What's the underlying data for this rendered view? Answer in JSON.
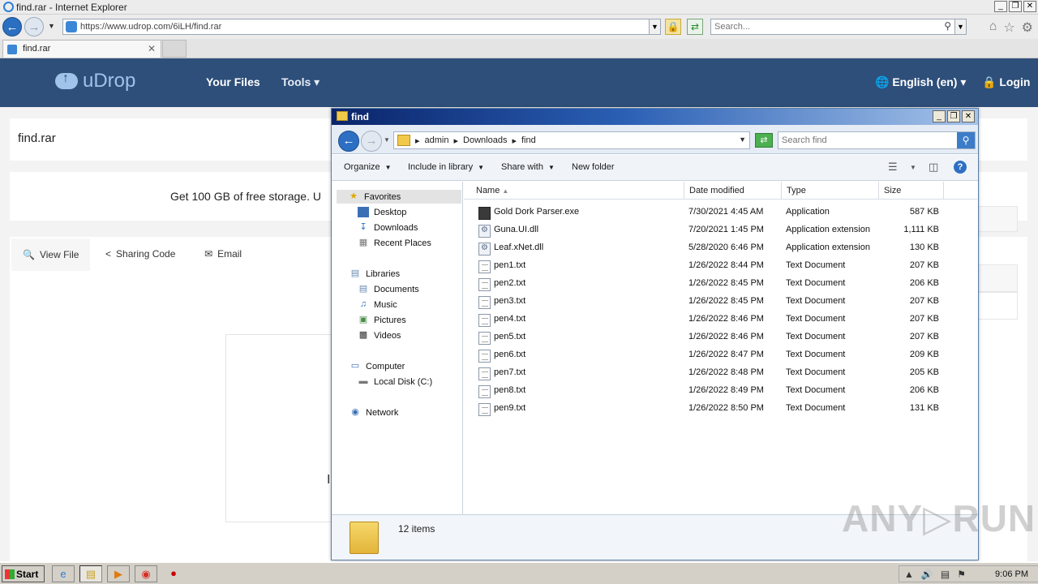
{
  "ie": {
    "title": "find.rar - Internet Explorer",
    "window_controls": [
      "_",
      "❐",
      "✕"
    ],
    "url": "https://www.udrop.com/6iLH/find.rar",
    "search_placeholder": "Search...",
    "tab_label": "find.rar",
    "tab_close": "✕"
  },
  "site": {
    "logo": "uDrop",
    "nav": {
      "your_files": "Your Files",
      "tools": "Tools ▾"
    },
    "language": "English (en) ▾",
    "login": "Login",
    "file_title": "find.rar",
    "promo": "Get 100 GB of free storage. U",
    "tabs": {
      "view_file": "View File",
      "sharing_code": "Sharing Code",
      "email": "Email"
    },
    "preview_char": "I"
  },
  "explorer": {
    "title": "find",
    "window_controls": [
      "_",
      "❐",
      "✕"
    ],
    "breadcrumb": [
      "admin",
      "Downloads",
      "find"
    ],
    "search_placeholder": "Search find",
    "commands": {
      "organize": "Organize",
      "include_in_library": "Include in library",
      "share_with": "Share with",
      "new_folder": "New folder"
    },
    "nav": {
      "favorites": "Favorites",
      "desktop": "Desktop",
      "downloads": "Downloads",
      "recent_places": "Recent Places",
      "libraries": "Libraries",
      "documents": "Documents",
      "music": "Music",
      "pictures": "Pictures",
      "videos": "Videos",
      "computer": "Computer",
      "local_disk": "Local Disk (C:)",
      "network": "Network"
    },
    "columns": {
      "name": "Name",
      "date_modified": "Date modified",
      "type": "Type",
      "size": "Size"
    },
    "files": [
      {
        "name": "Gold Dork Parser.exe",
        "date": "7/30/2021 4:45 AM",
        "type": "Application",
        "size": "587 KB",
        "icon": "exe"
      },
      {
        "name": "Guna.UI.dll",
        "date": "7/20/2021 1:45 PM",
        "type": "Application extension",
        "size": "1,111 KB",
        "icon": "dll"
      },
      {
        "name": "Leaf.xNet.dll",
        "date": "5/28/2020 6:46 PM",
        "type": "Application extension",
        "size": "130 KB",
        "icon": "dll"
      },
      {
        "name": "pen1.txt",
        "date": "1/26/2022 8:44 PM",
        "type": "Text Document",
        "size": "207 KB",
        "icon": "txt"
      },
      {
        "name": "pen2.txt",
        "date": "1/26/2022 8:45 PM",
        "type": "Text Document",
        "size": "206 KB",
        "icon": "txt"
      },
      {
        "name": "pen3.txt",
        "date": "1/26/2022 8:45 PM",
        "type": "Text Document",
        "size": "207 KB",
        "icon": "txt"
      },
      {
        "name": "pen4.txt",
        "date": "1/26/2022 8:46 PM",
        "type": "Text Document",
        "size": "207 KB",
        "icon": "txt"
      },
      {
        "name": "pen5.txt",
        "date": "1/26/2022 8:46 PM",
        "type": "Text Document",
        "size": "207 KB",
        "icon": "txt"
      },
      {
        "name": "pen6.txt",
        "date": "1/26/2022 8:47 PM",
        "type": "Text Document",
        "size": "209 KB",
        "icon": "txt"
      },
      {
        "name": "pen7.txt",
        "date": "1/26/2022 8:48 PM",
        "type": "Text Document",
        "size": "205 KB",
        "icon": "txt"
      },
      {
        "name": "pen8.txt",
        "date": "1/26/2022 8:49 PM",
        "type": "Text Document",
        "size": "206 KB",
        "icon": "txt"
      },
      {
        "name": "pen9.txt",
        "date": "1/26/2022 8:50 PM",
        "type": "Text Document",
        "size": "131 KB",
        "icon": "txt"
      }
    ],
    "status": "12 items"
  },
  "watermark": "ANY▷RUN",
  "taskbar": {
    "start": "Start",
    "clock": "9:06 PM"
  },
  "colors": {
    "site_header": "#2e4f7a",
    "explorer_title": "#0a246a",
    "accent_blue": "#2c6fc3"
  }
}
